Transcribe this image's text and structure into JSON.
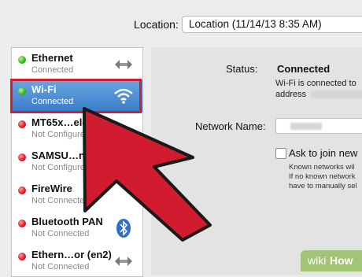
{
  "toolbar": {
    "location_label": "Location:",
    "location_value": "Location (11/14/13 8:35 AM)"
  },
  "sidebar": {
    "items": [
      {
        "name": "Ethernet",
        "status": "Connected",
        "state": "green",
        "icon": "ethernet-arrows-icon"
      },
      {
        "name": "Wi-Fi",
        "status": "Connected",
        "state": "green",
        "icon": "wifi-icon"
      },
      {
        "name": "MT65x…eld",
        "status": "Not Configured",
        "state": "red",
        "icon": "phone-icon"
      },
      {
        "name": "SAMSU…ndroid",
        "status": "Not Configured",
        "state": "red",
        "icon": "phone-icon"
      },
      {
        "name": "FireWire",
        "status": "Not Connected",
        "state": "red",
        "icon": "firewire-icon"
      },
      {
        "name": "Bluetooth PAN",
        "status": "Not Connected",
        "state": "red",
        "icon": "bluetooth-icon"
      },
      {
        "name": "Ethern…or (en2)",
        "status": "Not Connected",
        "state": "red",
        "icon": "ethernet-arrows-icon"
      }
    ]
  },
  "detail": {
    "status_label": "Status:",
    "status_value": "Connected",
    "status_desc_line1": "Wi-Fi is connected to",
    "status_desc_line2": "address",
    "network_name_label": "Network Name:",
    "ask_join_label": "Ask to join new",
    "known_line1": "Known networks wil",
    "known_line2": "If no known network",
    "known_line3": "have to manually sel"
  },
  "watermark": {
    "wiki": "wiki",
    "how": "How"
  },
  "colors": {
    "arrow": "#d11b2e",
    "selection": "#3a7bc8",
    "highlight": "#d02030"
  }
}
